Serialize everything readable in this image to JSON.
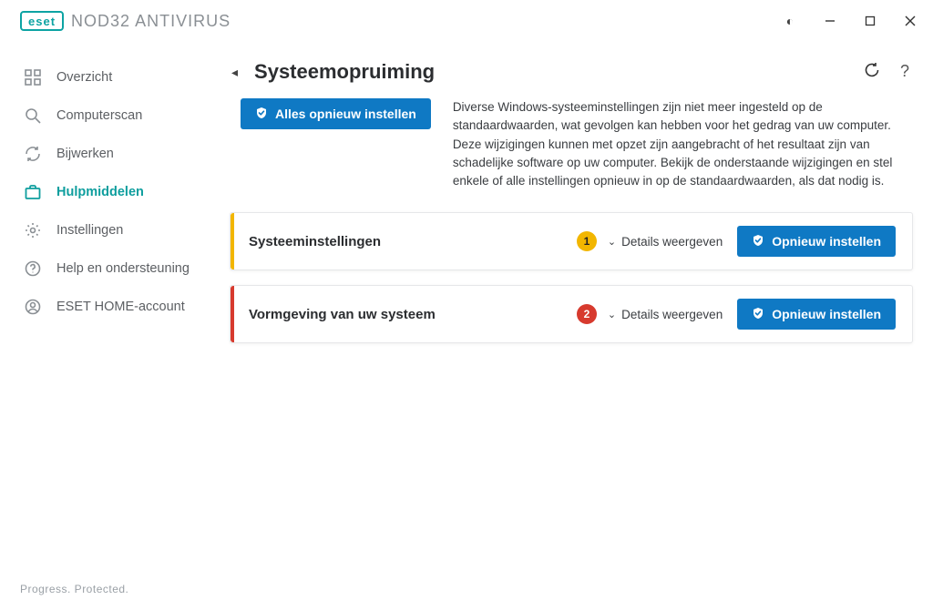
{
  "brand": {
    "badge": "eset",
    "product_bold": "NOD32",
    "product_rest": " ANTIVIRUS"
  },
  "nav": {
    "items": [
      {
        "label": "Overzicht"
      },
      {
        "label": "Computerscan"
      },
      {
        "label": "Bijwerken"
      },
      {
        "label": "Hulpmiddelen"
      },
      {
        "label": "Instellingen"
      },
      {
        "label": "Help en ondersteuning"
      },
      {
        "label": "ESET HOME-account"
      }
    ]
  },
  "page": {
    "title": "Systeemopruiming",
    "reset_all": "Alles opnieuw instellen",
    "intro": "Diverse Windows-systeeminstellingen zijn niet meer ingesteld op de standaardwaarden, wat gevolgen kan hebben voor het gedrag van uw computer. Deze wijzigingen kunnen met opzet zijn aangebracht of het resultaat zijn van schadelijke software op uw computer. Bekijk de onderstaande wijzigingen en stel enkele of alle instellingen opnieuw in op de standaardwaarden, als dat nodig is."
  },
  "cards": [
    {
      "title": "Systeeminstellingen",
      "count": "1",
      "details": "Details weergeven",
      "reset": "Opnieuw instellen"
    },
    {
      "title": "Vormgeving van uw systeem",
      "count": "2",
      "details": "Details weergeven",
      "reset": "Opnieuw instellen"
    }
  ],
  "footer": "Progress. Protected."
}
